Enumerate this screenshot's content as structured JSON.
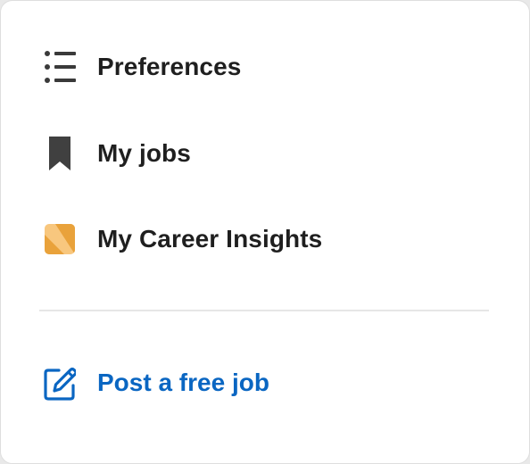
{
  "menu": {
    "items": [
      {
        "label": "Preferences",
        "icon": "list-icon"
      },
      {
        "label": "My jobs",
        "icon": "bookmark-icon"
      },
      {
        "label": "My Career Insights",
        "icon": "career-insights-icon"
      }
    ],
    "post_job": {
      "label": "Post a free job",
      "icon": "edit-icon"
    }
  },
  "colors": {
    "text": "#1f1f1f",
    "link": "#0a66c2",
    "bookmark": "#404040",
    "insights_light": "#f8c77e",
    "insights_dark": "#e9a23b",
    "divider": "#e6e6e6"
  }
}
